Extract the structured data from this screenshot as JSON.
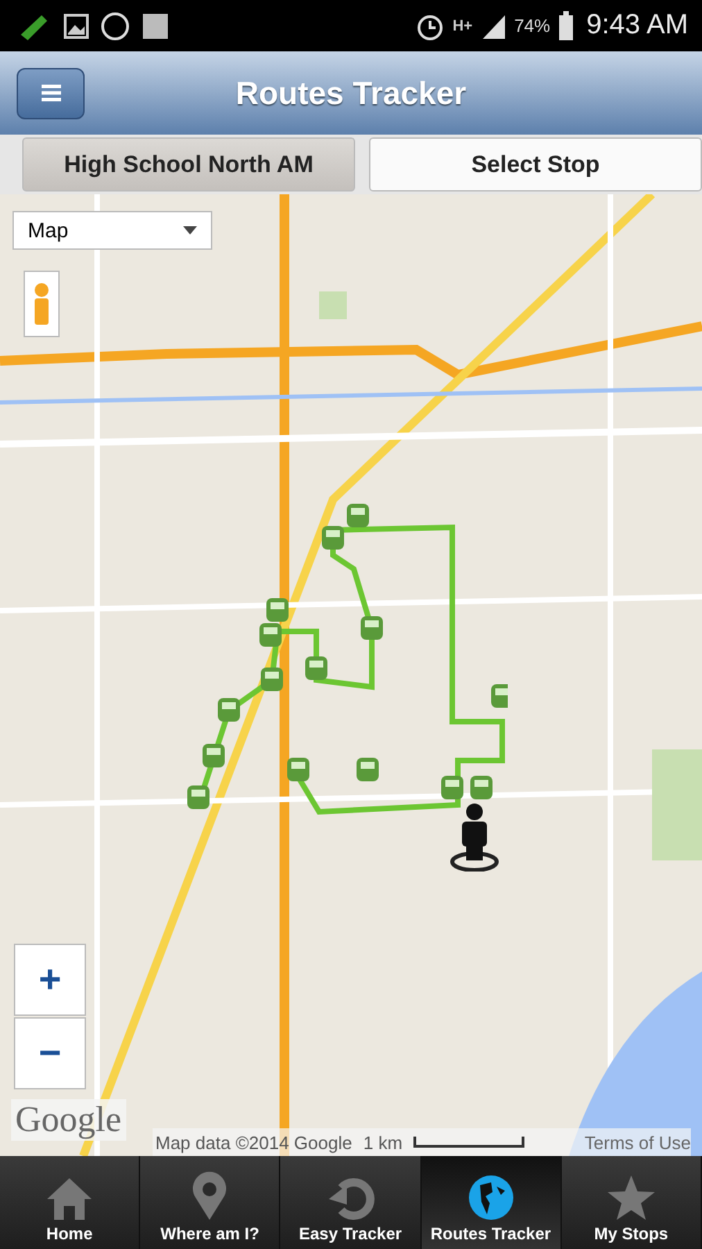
{
  "status_bar": {
    "network": "H+",
    "battery": "74%",
    "time": "9:43 AM"
  },
  "header": {
    "title": "Routes Tracker"
  },
  "segments": [
    {
      "label": "High School North AM",
      "selected": true
    },
    {
      "label": "Select Stop",
      "selected": false
    }
  ],
  "map": {
    "type_select": "Map",
    "zoom_in": "+",
    "zoom_out": "−",
    "logo": "Google",
    "attribution": "Map data ©2014 Google",
    "scale": "1 km",
    "terms": "Terms of Use"
  },
  "nav": [
    {
      "kind": "home",
      "label": "Home",
      "selected": false
    },
    {
      "kind": "pin",
      "label": "Where am I?",
      "selected": false
    },
    {
      "kind": "refresh",
      "label": "Easy Tracker",
      "selected": false
    },
    {
      "kind": "globe",
      "label": "Routes Tracker",
      "selected": true
    },
    {
      "kind": "star",
      "label": "My Stops",
      "selected": false
    }
  ]
}
